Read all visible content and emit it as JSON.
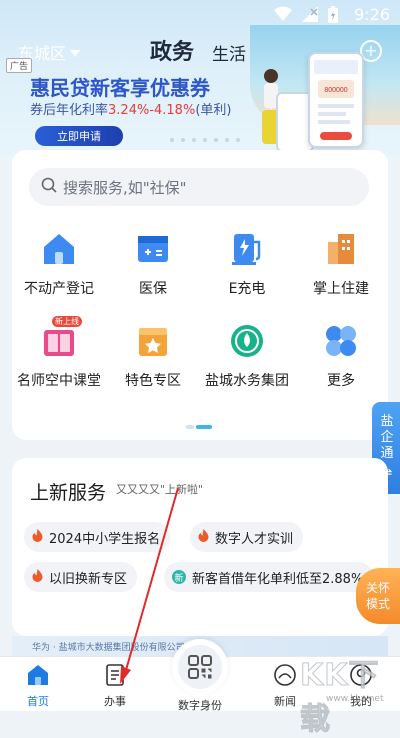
{
  "status_bar": {
    "time": "9:26"
  },
  "header": {
    "district": "东城区",
    "tabs": [
      {
        "label": "政务",
        "active": true
      },
      {
        "label": "生活",
        "active": false
      }
    ],
    "plus_icon": "plus-circle-icon"
  },
  "banner": {
    "ad_tag": "广告",
    "title": "惠民贷新客享优惠券",
    "subtitle_prefix": "券后年化利率",
    "subtitle_rate": "3.24%-4.18%",
    "subtitle_suffix": "(单利)",
    "button": "立即申请",
    "phone_amount": "800000"
  },
  "search": {
    "placeholder": "搜索服务,如\"社保\""
  },
  "services": [
    {
      "label": "不动产登记",
      "icon": "house-icon"
    },
    {
      "label": "医保",
      "icon": "medical-card-icon"
    },
    {
      "label": "E充电",
      "icon": "charging-station-icon"
    },
    {
      "label": "掌上住建",
      "icon": "building-icon"
    },
    {
      "label": "名师空中课堂",
      "icon": "book-icon",
      "badge": "新上线"
    },
    {
      "label": "特色专区",
      "icon": "star-box-icon"
    },
    {
      "label": "盐城水务集团",
      "icon": "water-drop-icon"
    },
    {
      "label": "更多",
      "icon": "more-grid-icon"
    }
  ],
  "side_tab": {
    "lines": [
      "盐",
      "企",
      "通"
    ],
    "arrow": "⇌"
  },
  "care_tab": {
    "line1": "关怀",
    "line2": "模式"
  },
  "new_services": {
    "title": "上新服务",
    "subtitle": "又又又又\"上新啦\"",
    "chips": [
      {
        "label": "2024中小学生报名",
        "icon": "fire-icon"
      },
      {
        "label": "数字人才实训",
        "icon": "fire-icon"
      },
      {
        "label": "以旧换新专区",
        "icon": "fire-icon"
      },
      {
        "label": "新客首借年化单利低至2.88%",
        "icon": "new-badge-icon",
        "icon_text": "新"
      }
    ]
  },
  "strip_text": "华为 · 盐城市大数据集团股份有限公司",
  "bottom_nav": [
    {
      "label": "首页",
      "icon": "home-icon",
      "active": true
    },
    {
      "label": "办事",
      "icon": "document-icon",
      "active": false
    },
    {
      "label": "数字身份",
      "icon": "qr-code-icon",
      "active": false
    },
    {
      "label": "新闻",
      "icon": "news-icon",
      "active": false
    },
    {
      "label": "我的",
      "icon": "user-icon",
      "active": false
    }
  ],
  "watermark": {
    "text": "KK下载",
    "url": "www.kkx.net"
  },
  "colors": {
    "accent": "#1e7be0",
    "banner_blue": "#2d56c8",
    "rate_red": "#e83a3a",
    "side_tab": "#2f7fe0",
    "care_orange": "#f48a2a"
  }
}
